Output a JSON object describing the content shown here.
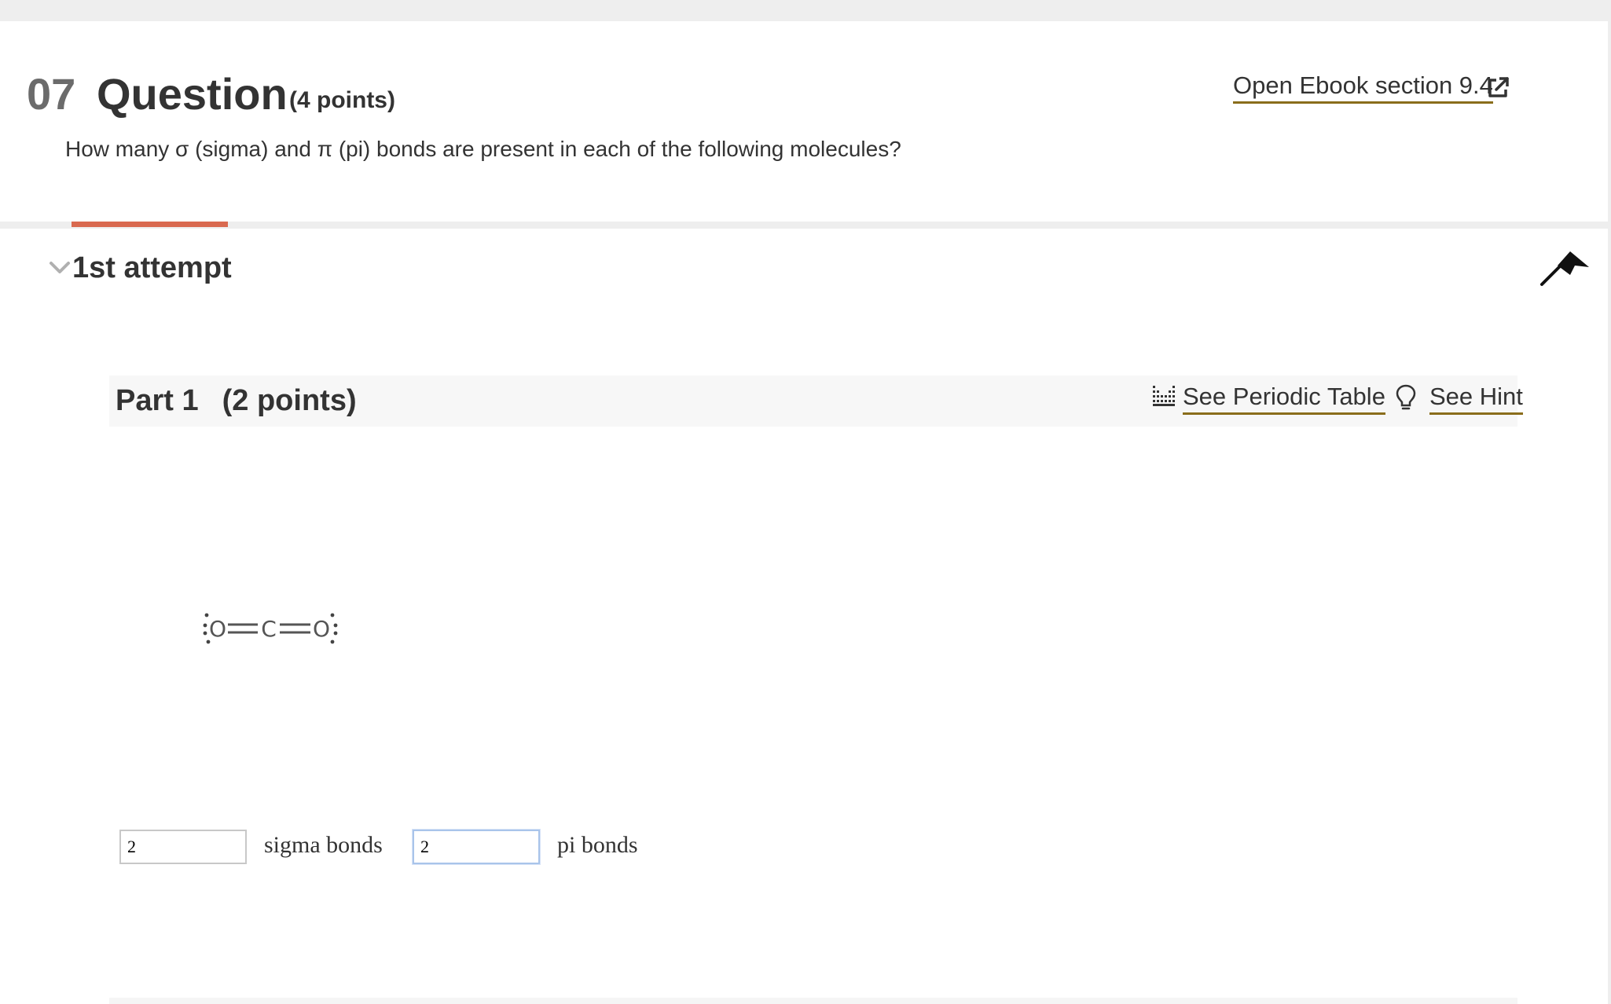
{
  "question": {
    "number": "07",
    "title": "Question",
    "points": "(4 points)",
    "prompt": "How many σ (sigma) and π (pi) bonds are present in each of the following molecules?",
    "ebook_link": "Open Ebook section 9.4"
  },
  "attempt": {
    "label": "1st attempt"
  },
  "part": {
    "title": "Part 1",
    "points": "(2 points)",
    "periodic_table_link": "See Periodic Table",
    "hint_link": "See Hint"
  },
  "molecule": {
    "atoms": [
      "O",
      "C",
      "O"
    ]
  },
  "answers": {
    "sigma_value": "2",
    "sigma_label": "sigma bonds",
    "pi_value": "2",
    "pi_label": "pi bonds"
  },
  "colors": {
    "accent_tab": "#d9694f",
    "link_underline": "#8a6d1b",
    "text": "#333333",
    "muted_number": "#6b6b6b"
  },
  "icons": {
    "ebook": "external-link-icon",
    "periodic_table": "periodic-table-icon",
    "hint": "lightbulb-icon",
    "attempt_toggle": "chevron-down-icon",
    "collapse": "collapse-arrow-icon"
  }
}
